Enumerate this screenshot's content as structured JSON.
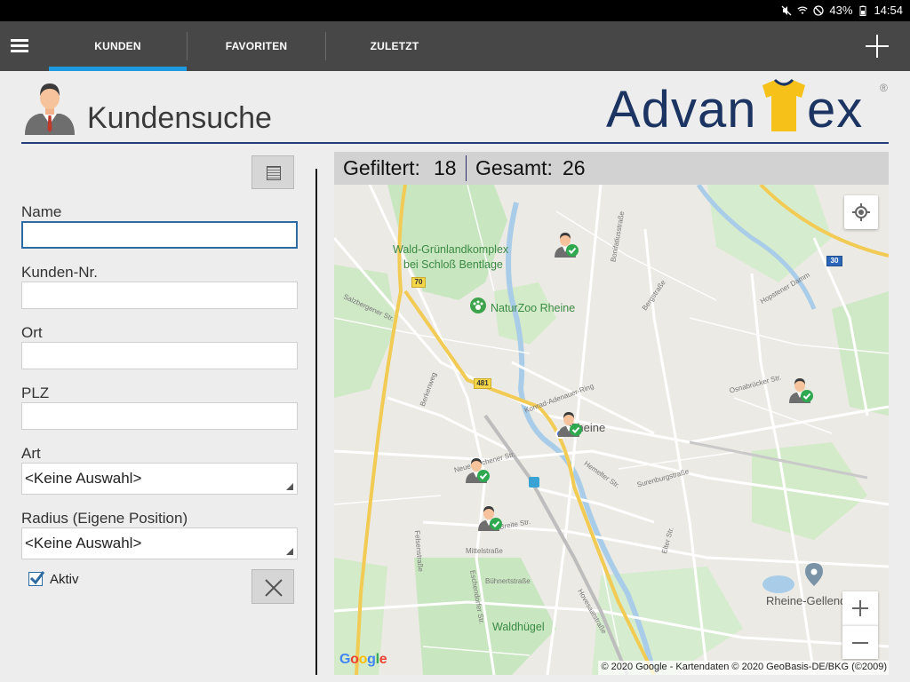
{
  "status_bar": {
    "battery": "43%",
    "time": "14:54",
    "icons": [
      "mute-icon",
      "wifi-icon",
      "do-not-disturb-icon",
      "battery-icon"
    ]
  },
  "tabs": [
    {
      "label": "KUNDEN",
      "active": true
    },
    {
      "label": "FAVORITEN",
      "active": false
    },
    {
      "label": "ZULETZT",
      "active": false
    }
  ],
  "header": {
    "title": "Kundensuche",
    "logo_text": "Advantex",
    "logo_registered": "®"
  },
  "form": {
    "name_label": "Name",
    "name_value": "",
    "customer_no_label": "Kunden-Nr.",
    "customer_no_value": "",
    "city_label": "Ort",
    "city_value": "",
    "zip_label": "PLZ",
    "zip_value": "",
    "type_label": "Art",
    "type_value": "<Keine Auswahl>",
    "radius_label": "Radius (Eigene Position)",
    "radius_value": "<Keine Auswahl>",
    "active_label": "Aktiv",
    "active_checked": true
  },
  "counts": {
    "filtered_label": "Gefiltert:",
    "filtered_value": "18",
    "total_label": "Gesamt:",
    "total_value": "26"
  },
  "map": {
    "places": {
      "forest": "Wald-Grünlandkomplex",
      "forest_2": "bei Schloß Bentlage",
      "zoo": "NaturZoo Rheine",
      "city": "Rheine",
      "district": "Rheine-Gellendorf",
      "hill": "Waldhügel"
    },
    "streets": {
      "salzbergener": "Salzbergener Str.",
      "bonifatius": "Bonifatiusstraße",
      "bergstrasse": "Bergstraße",
      "hopstener": "Hopstener Damm",
      "osnabruecker": "Osnabrücker Str.",
      "konrad": "Konrad-Adenauer-Ring",
      "breite": "Breite Str.",
      "neuenkirchener": "Neuenkirchener Str.",
      "mittelstrasse": "Mittelstraße",
      "buehnert": "Bühnertstraße",
      "hemelter": "Hemelter Str.",
      "surenburg": "Surenburgstraße",
      "elter": "Elter Str.",
      "felsenstrasse": "Felsenstraße",
      "eschendorfer": "Eschendorfer Str.",
      "hovesaatstrasse": "Hovesaatstraße",
      "berkenweg": "Berkenweg"
    },
    "road_numbers": [
      "70",
      "481",
      "30"
    ],
    "google": "Google",
    "attribution": "© 2020 Google - Kartendaten © 2020 GeoBasis-DE/BKG (©2009)"
  }
}
